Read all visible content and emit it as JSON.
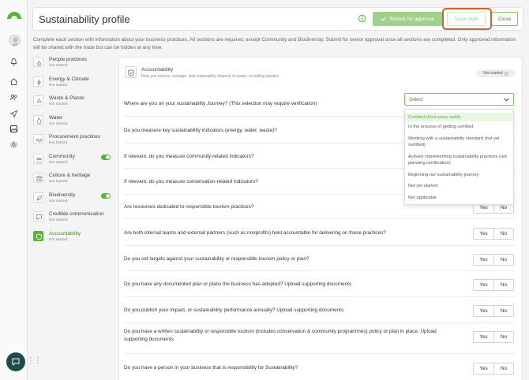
{
  "header": {
    "title": "Sustainability profile",
    "submit_label": "Submit for approval",
    "draft_label": "Save draft",
    "close_label": "Close"
  },
  "intro": "Complete each section with information about your business practices. All sections are required, except Community and Biodiversity. Submit for senior approval once all sections are completed. Only approved information will be shared with the trade but can be hidden at any time.",
  "sections": [
    {
      "name": "People practices",
      "status": "Not started",
      "icon": "people-icon",
      "toggle": false
    },
    {
      "name": "Energy & Climate",
      "status": "Not started",
      "icon": "lightning-icon",
      "toggle": false
    },
    {
      "name": "Waste & Plastic",
      "status": "Not started",
      "icon": "recycle-icon",
      "toggle": false
    },
    {
      "name": "Water",
      "status": "Not started",
      "icon": "droplet-icon",
      "toggle": false
    },
    {
      "name": "Procurement practices",
      "status": "Not started",
      "icon": "handshake-icon",
      "toggle": false
    },
    {
      "name": "Community",
      "status": "Not started",
      "icon": "community-icon",
      "toggle": true
    },
    {
      "name": "Culture & heritage",
      "status": "Not started",
      "icon": "temple-icon",
      "toggle": false
    },
    {
      "name": "Biodiversity",
      "status": "Not started",
      "icon": "leaf-icon",
      "toggle": true
    },
    {
      "name": "Credible communication",
      "status": "Not started",
      "icon": "chat-icon",
      "toggle": false
    },
    {
      "name": "Accountability",
      "status": "Not started",
      "icon": "shield-icon",
      "toggle": false,
      "active": true
    }
  ],
  "accountability": {
    "title": "Accountability",
    "subtitle": "How you reduce, manage, and responsibly dispose of waste, including plastics",
    "status_badge": "Not started"
  },
  "select": {
    "value": "Select",
    "options": [
      "Certified (third-party audit)",
      "In the process of getting certified",
      "Working with a sustainability standard (not yet certified)",
      "Actively implementing sustainability practices (not planning certification)",
      "Beginning our sustainability journey",
      "Not yet started",
      "Not applicable"
    ]
  },
  "questions": [
    "Where are you on your sustainability Journey? (This selection may require verification)",
    "Do you measure key sustainability indicators (energy, water, waste)?",
    "If relevant, do you measure community-related indicators?",
    "If relevant, do you measure conservation-related indicators?",
    "Are resources dedicated to responsible tourism practices?",
    "Are both internal teams and external partners (such as nonprofits) held accountable for delivering on these practices?",
    "Do you set targets against your sustainability or responsible tourism policy or plan?",
    "Do you have any documented plan or plans the business has adopted? Upload supporting documents",
    "Do you publish your impact, or sustainability performance annually? Upload supporting documents",
    "Do you have a written sustainability or responsible tourism (includes conservation & community programmes) policy or plan in place. Upload supporting documents",
    "Do you have a person in your business that is responsibility for Sustainability?"
  ],
  "yes_label": "Yes",
  "no_label": "No",
  "colors": {
    "accent": "#5cb13b",
    "submit_bg": "#9fd18c",
    "highlight": "#c8622f",
    "chat_bg": "#1f4a4f"
  }
}
